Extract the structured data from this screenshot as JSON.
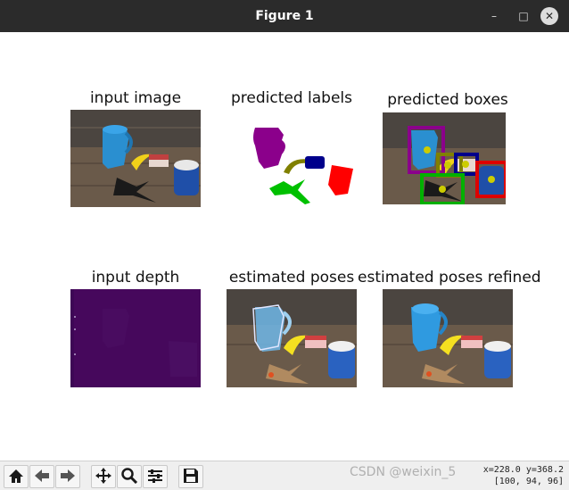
{
  "window": {
    "title": "Figure 1"
  },
  "panels": {
    "input_image": "input image",
    "predicted_labels": "predicted labels",
    "predicted_boxes": "predicted boxes",
    "input_depth": "input depth",
    "estimated_poses": "estimated poses",
    "estimated_poses_refined": "estimated poses refined"
  },
  "toolbar": {
    "buttons": [
      "home",
      "back",
      "forward",
      "pan",
      "zoom",
      "configure-subplots",
      "save"
    ],
    "status_line1": "x=228.0 y=368.2",
    "status_line2": "[100, 94, 96]"
  },
  "watermark": "CSDN @weixin_5",
  "colors": {
    "titlebar": "#2b2b2b",
    "depth": "#46085c",
    "label_pitcher": "#8b008b",
    "label_banana": "#808000",
    "label_can": "#00008b",
    "label_cup": "#ff0000",
    "label_clamp": "#00c000",
    "centroid": "#cccc00"
  }
}
